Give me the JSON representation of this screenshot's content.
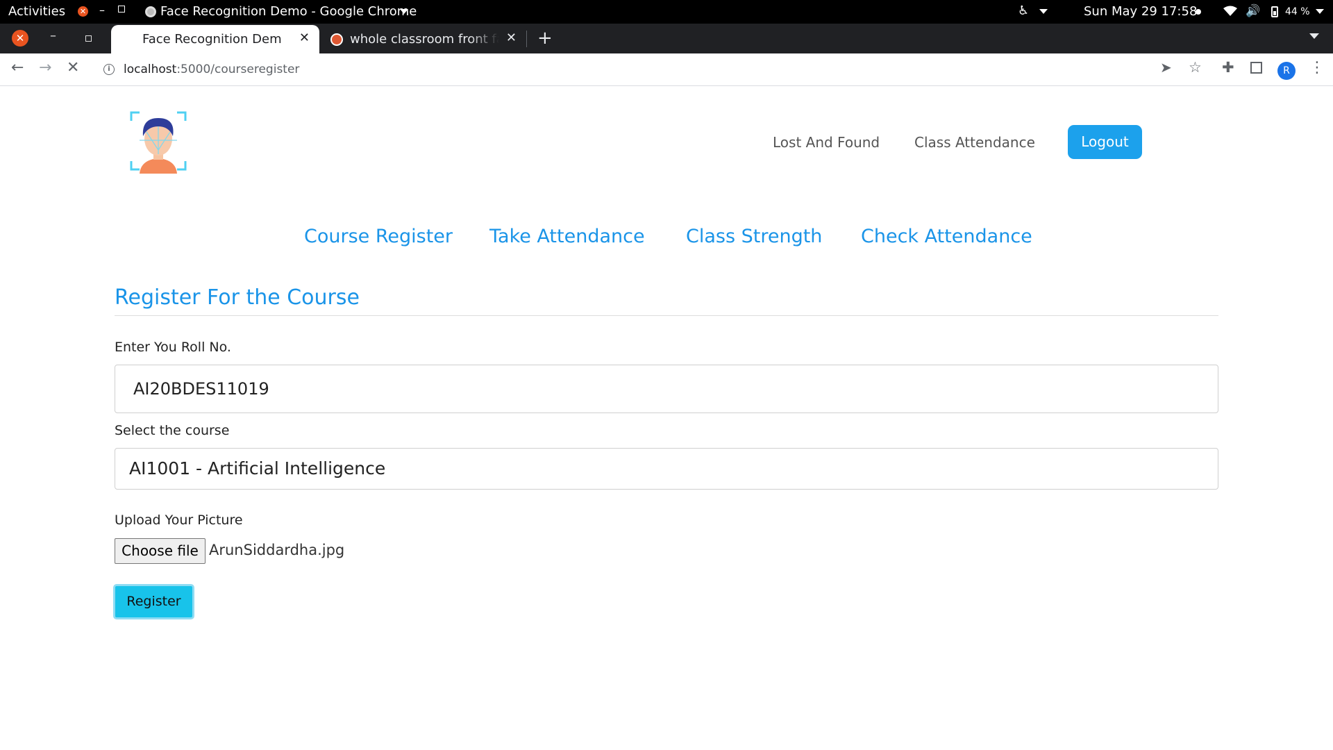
{
  "os": {
    "activities": "Activities",
    "app_title": "Face Recognition Demo - Google Chrome",
    "clock": "Sun May 29  17:58",
    "battery": "44 %"
  },
  "browser": {
    "tabs": [
      {
        "title": "Face Recognition Demo"
      },
      {
        "title": "whole classroom front face"
      }
    ],
    "url_host": "localhost",
    "url_path": ":5000/courseregister",
    "avatar_letter": "R"
  },
  "header": {
    "nav": [
      "Lost And Found",
      "Class Attendance"
    ],
    "logout": "Logout"
  },
  "subnav": [
    "Course Register",
    "Take Attendance",
    "Class Strength",
    "Check Attendance"
  ],
  "form": {
    "title": "Register For the Course",
    "roll_label": "Enter You Roll No.",
    "roll_value": "AI20BDES11019",
    "course_label": "Select the course",
    "course_value": "AI1001 - Artificial Intelligence",
    "upload_label": "Upload Your Picture",
    "file_button": "Choose file",
    "file_name": "ArunSiddardha.jpg",
    "submit": "Register"
  },
  "colors": {
    "accent": "#1a94e8",
    "logout_bg": "#1ca1ec",
    "register_bg": "#18c3ea"
  }
}
